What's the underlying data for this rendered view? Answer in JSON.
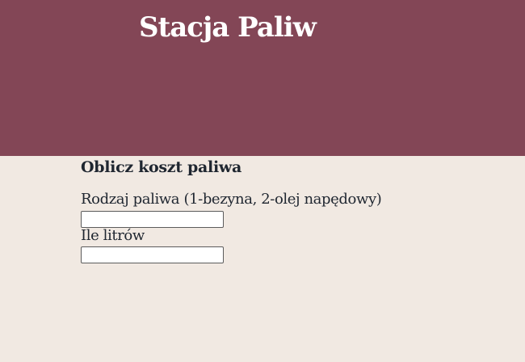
{
  "header": {
    "title": "Stacja Paliw"
  },
  "form": {
    "heading": "Oblicz koszt paliwa",
    "fuel_type": {
      "label": "Rodzaj paliwa (1-bezyna, 2-olej napędowy)",
      "value": ""
    },
    "liters": {
      "label": "Ile litrów",
      "value": ""
    }
  },
  "colors": {
    "header_bg": "#834656",
    "page_bg": "#f1e9e2",
    "text": "#1f2630"
  }
}
